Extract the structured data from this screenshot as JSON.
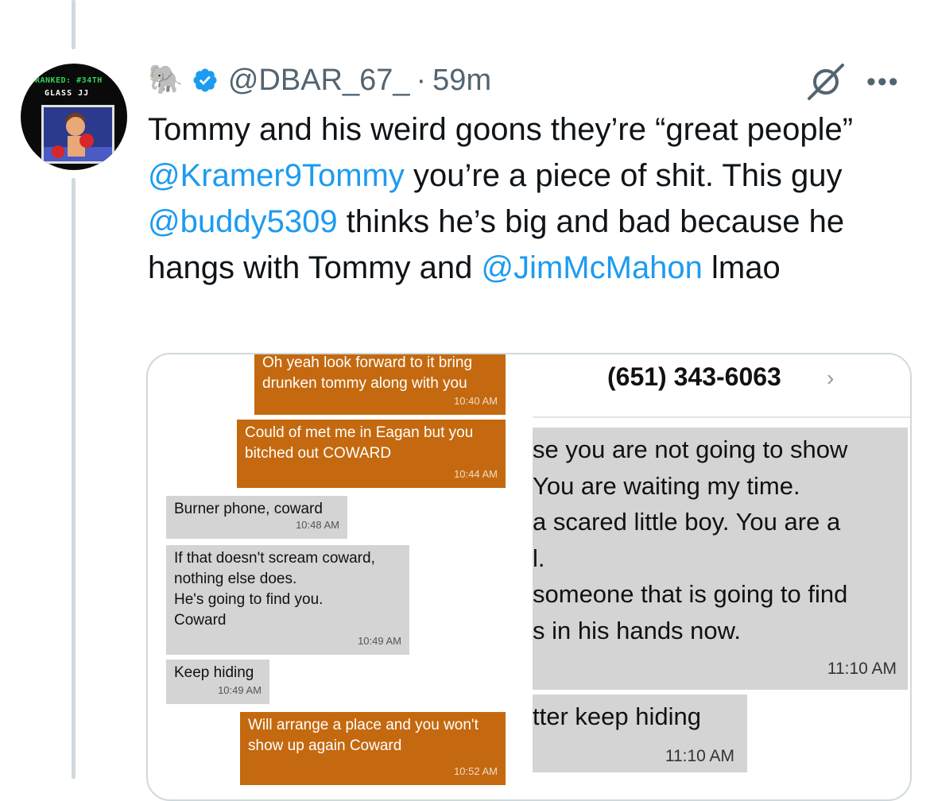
{
  "tweet": {
    "emoji": "🐘",
    "handle": "@DBAR_67_",
    "separator": "·",
    "time": "59m",
    "avatar_text_line1": "RANKED: #34TH",
    "avatar_text_line2": "GLASS JJ",
    "text_segments": [
      {
        "text": "Tommy and his weird goons they’re “great people” ",
        "type": "text"
      },
      {
        "text": "@Kramer9Tommy",
        "type": "mention"
      },
      {
        "text": " you’re a piece of shit. This guy ",
        "type": "text"
      },
      {
        "text": "@buddy5309",
        "type": "mention"
      },
      {
        "text": " thinks he’s big and bad because he hangs with Tommy and ",
        "type": "text"
      },
      {
        "text": "@JimMcMahon",
        "type": "mention"
      },
      {
        "text": " lmao",
        "type": "text"
      }
    ],
    "mention_color": "#1d9bf0"
  },
  "screenshot_left": {
    "messages": [
      {
        "text": "Oh yeah look forward to it bring\ndrunken tommy along with you",
        "time": "10:40 AM",
        "side": "sent"
      },
      {
        "text": "Could of met me in Eagan but you\nbitched out COWARD",
        "time": "10:44 AM",
        "side": "sent"
      },
      {
        "text": "Burner phone, coward",
        "time": "10:48 AM",
        "side": "received"
      },
      {
        "text": "If that doesn't scream coward,\nnothing else does.\nHe's going to find you.\nCoward",
        "time": "10:49 AM",
        "side": "received"
      },
      {
        "text": "Keep hiding",
        "time": "10:49 AM",
        "side": "received"
      },
      {
        "text": "Will arrange a place and you won't\nshow up again Coward",
        "time": "10:52 AM",
        "side": "sent"
      }
    ],
    "sent_color": "#c4690f",
    "received_color": "#d4d4d4"
  },
  "screenshot_right": {
    "phone_number": "(651) 343-6063",
    "chevron": "›",
    "big_message_lines": [
      "se you are not going to show",
      "You are waiting my time.",
      "a scared little boy. You are a",
      "l.",
      "someone that is going to find",
      "s in his hands now."
    ],
    "big_message_time": "11:10 AM",
    "small_message": "tter keep hiding",
    "small_message_time": "11:10 AM"
  },
  "icons": [
    "verified-badge-icon",
    "grok-icon",
    "more-options-icon"
  ]
}
